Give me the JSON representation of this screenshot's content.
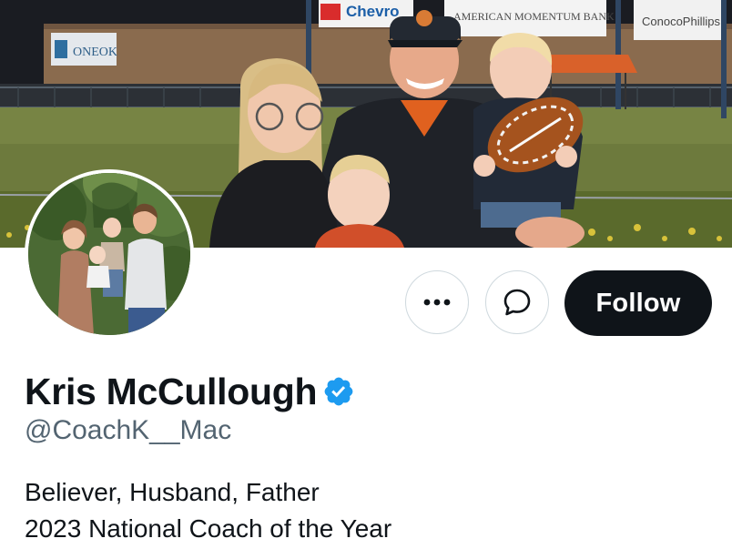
{
  "banner": {
    "sponsor_signs": [
      "Chevro",
      "AMERICAN MOMENTUM BANK",
      "ConocoPhillips",
      "ONEOK"
    ]
  },
  "profile": {
    "display_name": "Kris McCullough",
    "handle": "@CoachK__Mac",
    "verified": true,
    "bio_lines": [
      "Believer, Husband, Father",
      "2023 National Coach of the Year"
    ]
  },
  "actions": {
    "more_icon": "ellipsis-icon",
    "message_icon": "message-bubble-icon",
    "follow_label": "Follow"
  },
  "colors": {
    "primary_text": "#0f1419",
    "secondary_text": "#536471",
    "verified_blue": "#1d9bf0",
    "follow_button_bg": "#0f1419",
    "button_border": "#cfd9de"
  }
}
